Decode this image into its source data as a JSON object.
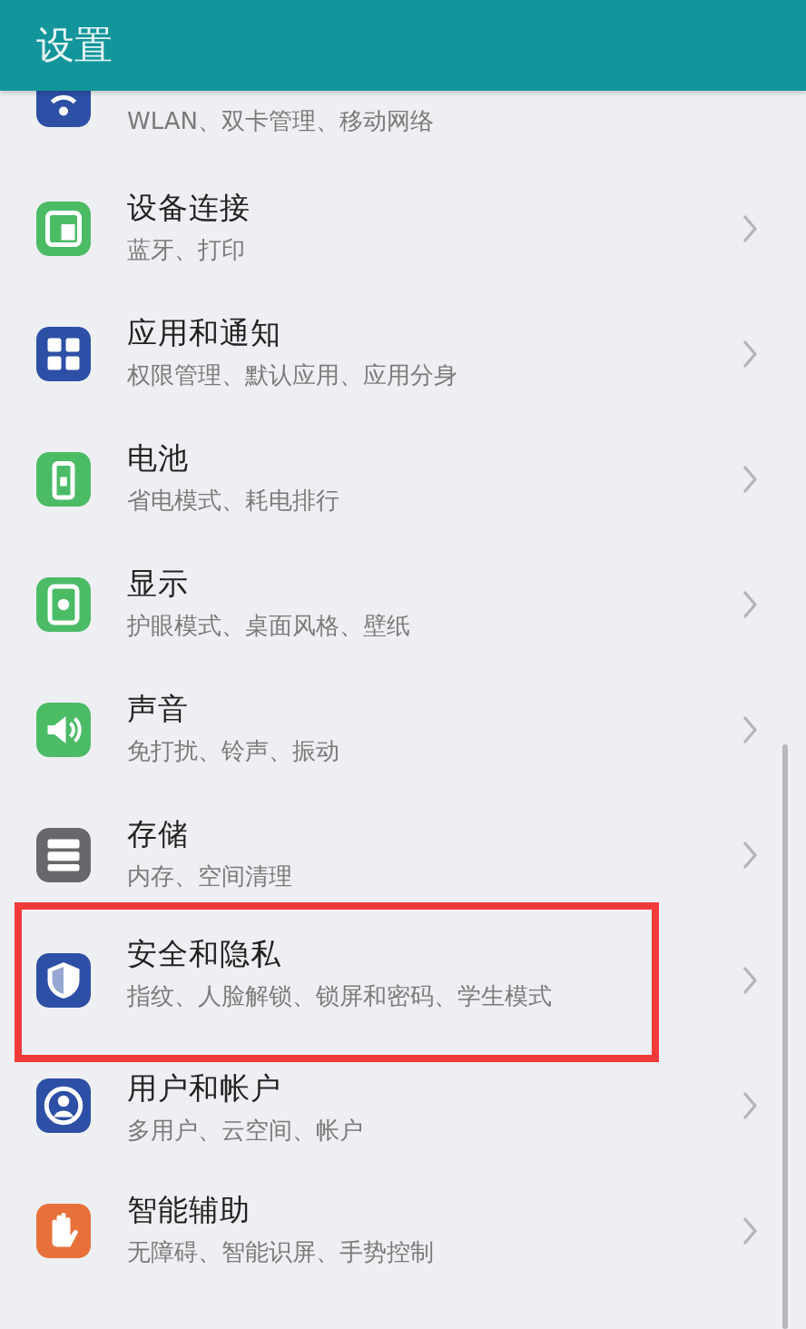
{
  "header": {
    "title": "设置"
  },
  "items": [
    {
      "kind": "wifi",
      "color": "#2d4fa6",
      "subtitle": "WLAN、双卡管理、移动网络",
      "highlighted": false
    },
    {
      "kind": "devices",
      "color": "#4cbb66",
      "title": "设备连接",
      "subtitle": "蓝牙、打印",
      "highlighted": false
    },
    {
      "kind": "apps",
      "color": "#2d4fa6",
      "title": "应用和通知",
      "subtitle": "权限管理、默认应用、应用分身",
      "highlighted": false
    },
    {
      "kind": "battery",
      "color": "#4cbb66",
      "title": "电池",
      "subtitle": "省电模式、耗电排行",
      "highlighted": false
    },
    {
      "kind": "display",
      "color": "#4cbb66",
      "title": "显示",
      "subtitle": "护眼模式、桌面风格、壁纸",
      "highlighted": false
    },
    {
      "kind": "sound",
      "color": "#4cbb66",
      "title": "声音",
      "subtitle": "免打扰、铃声、振动",
      "highlighted": false
    },
    {
      "kind": "storage",
      "color": "#66686c",
      "title": "存储",
      "subtitle": "内存、空间清理",
      "highlighted": false
    },
    {
      "kind": "shield",
      "color": "#2d4fa6",
      "title": "安全和隐私",
      "subtitle": "指纹、人脸解锁、锁屏和密码、学生模式",
      "highlighted": true
    },
    {
      "kind": "user",
      "color": "#2d4fa6",
      "title": "用户和帐户",
      "subtitle": "多用户、云空间、帐户",
      "highlighted": false
    },
    {
      "kind": "hand",
      "color": "#e8703a",
      "title": "智能辅助",
      "subtitle": "无障碍、智能识屏、手势控制",
      "highlighted": false
    }
  ]
}
